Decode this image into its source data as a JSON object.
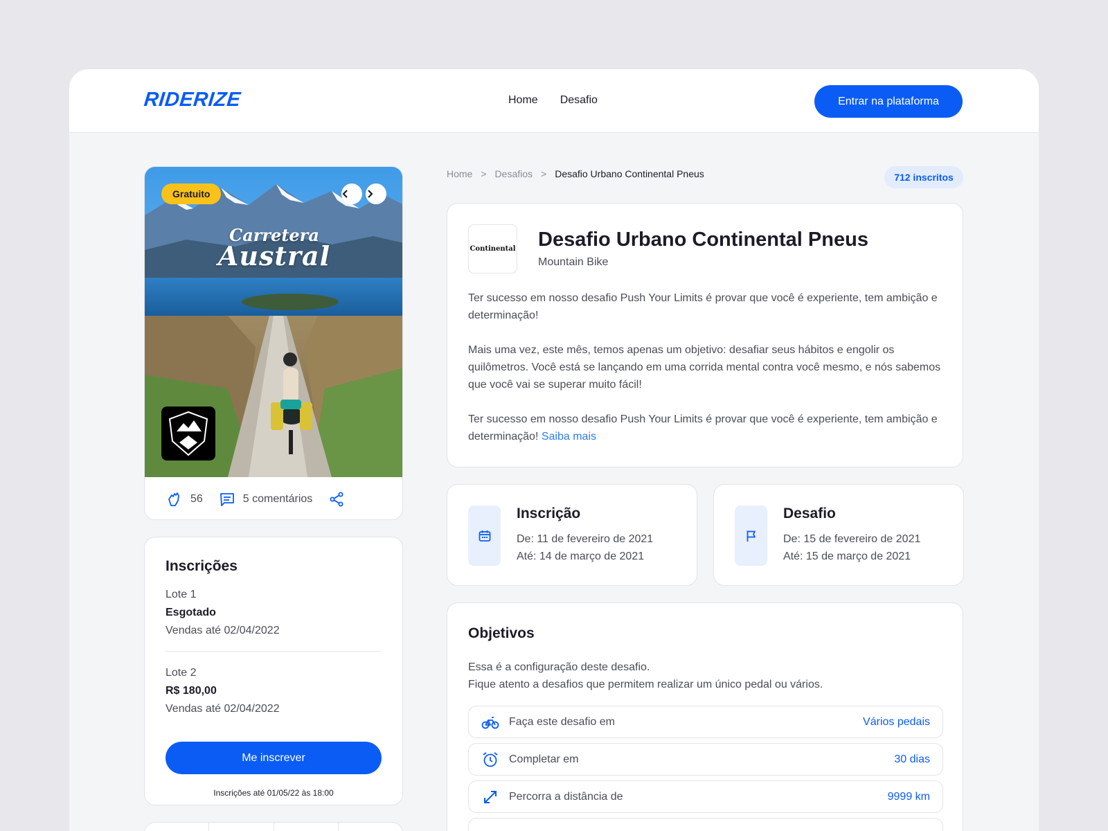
{
  "brand": {
    "logo": "RIDERIZE"
  },
  "nav": {
    "items": [
      "Home",
      "Desafio"
    ],
    "cta": "Entrar na plataforma"
  },
  "poster": {
    "badge": "Gratuito",
    "title_line1": "Carretera",
    "title_line2": "Austral",
    "emblem_text": "Carretera Austral",
    "likes": "56",
    "comments": "5 comentários"
  },
  "registration": {
    "title": "Inscrições",
    "lots": [
      {
        "name": "Lote 1",
        "status": "Esgotado",
        "until": "Vendas até 02/04/2022"
      },
      {
        "name": "Lote 2",
        "status": "R$ 180,00",
        "until": "Vendas até 02/04/2022"
      }
    ],
    "button": "Me inscrever",
    "note": "Inscrições até 01/05/22 às 18:00"
  },
  "breadcrumb": {
    "items": [
      "Home",
      "Desafios",
      "Desafio Urbano Continental Pneus"
    ],
    "separator": ">"
  },
  "subscribers": "712 inscritos",
  "challenge": {
    "sponsor_logo": "Continental",
    "title": "Desafio Urbano Continental Pneus",
    "category": "Mountain Bike",
    "paragraphs": [
      "Ter sucesso em nosso desafio Push Your Limits é provar que você é experiente, tem ambição e determinação!",
      "Mais uma vez, este mês, temos apenas um objetivo: desafiar seus hábitos e engolir os quilômetros. Você está se lançando em uma corrida mental contra você mesmo, e nós sabemos que você vai se superar muito fácil!",
      "Ter sucesso em nosso desafio Push Your Limits é provar que você é experiente, tem ambição e determinação!"
    ],
    "more_link": "Saiba mais"
  },
  "dates": {
    "inscricao": {
      "title": "Inscrição",
      "from": "De: 11 de fevereiro de 2021",
      "to": "Até: 14 de março de 2021",
      "icon": "calendar-icon"
    },
    "desafio": {
      "title": "Desafio",
      "from": "De: 15 de fevereiro de 2021",
      "to": "Até: 15 de março de 2021",
      "icon": "flag-icon"
    }
  },
  "objectives": {
    "title": "Objetivos",
    "line1": "Essa é a configuração deste desafio.",
    "line2": "Fique atento a desafios que permitem realizar um  único pedal ou vários.",
    "rows": [
      {
        "label": "Faça este desafio em",
        "value": "Vários pedais",
        "icon": "bike-icon"
      },
      {
        "label": "Completar em",
        "value": "30 dias",
        "icon": "alarm-icon"
      },
      {
        "label": "Percorra a distância de",
        "value": "9999 km",
        "icon": "expand-icon"
      }
    ]
  },
  "colors": {
    "primary": "#0a5cf5",
    "badge": "#f8c21a",
    "background": "#f4f5f7"
  }
}
